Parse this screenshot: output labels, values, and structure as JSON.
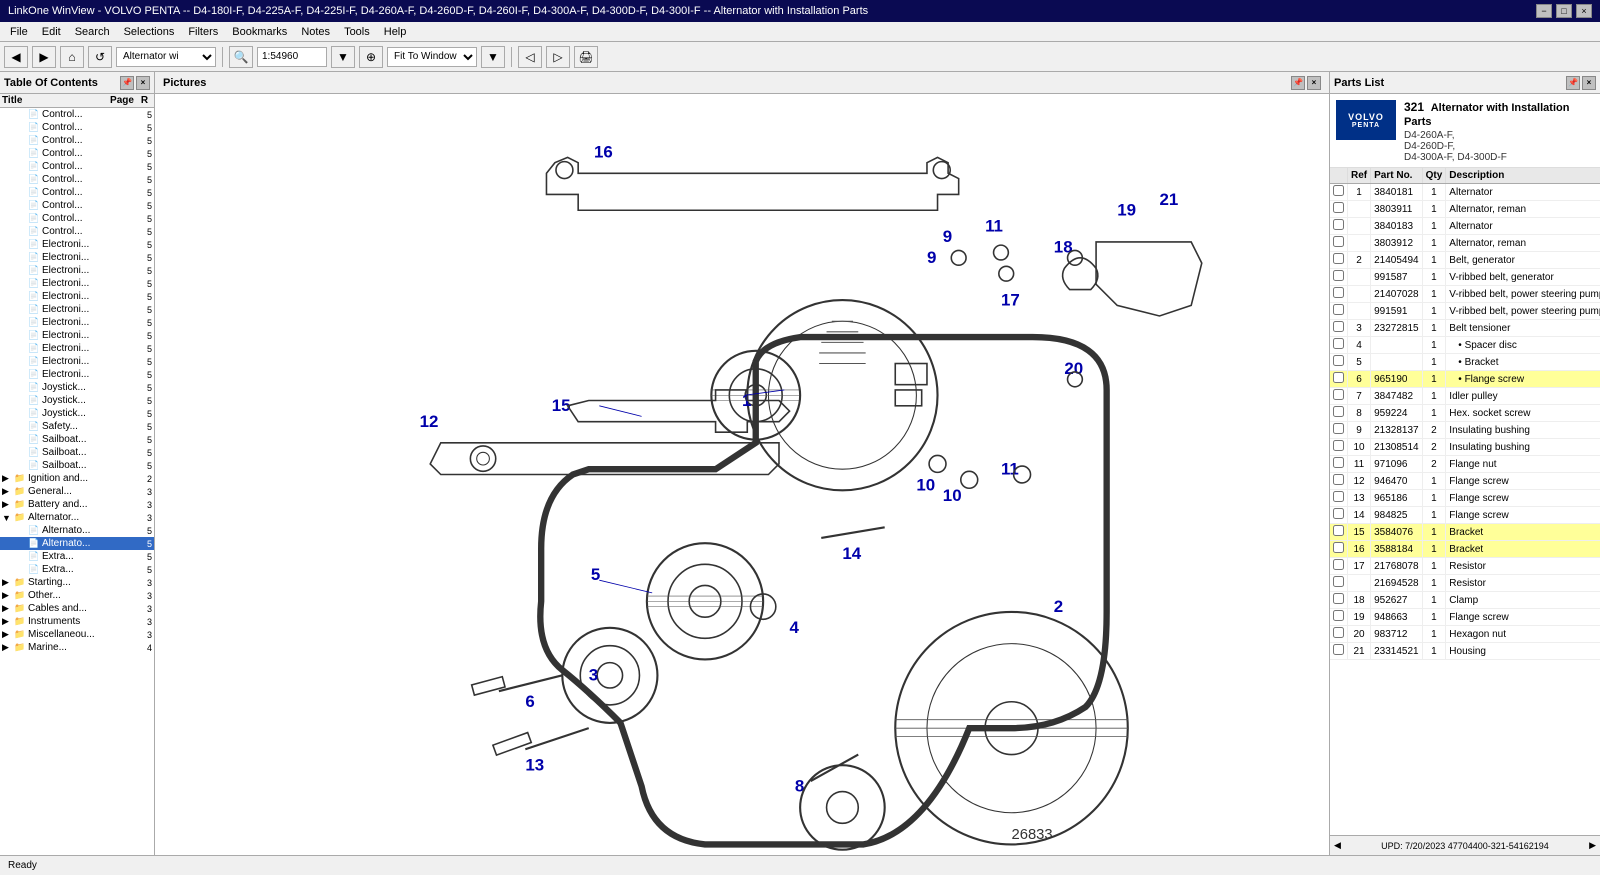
{
  "window": {
    "title": "LinkOne WinView - VOLVO PENTA -- D4-180I-F, D4-225A-F, D4-225I-F, D4-260A-F, D4-260D-F, D4-260I-F, D4-300A-F, D4-300D-F, D4-300I-F -- Alternator with Installation Parts",
    "controls": [
      "−",
      "□",
      "×"
    ]
  },
  "menu": {
    "items": [
      "File",
      "Edit",
      "Search",
      "Selections",
      "Filters",
      "Bookmarks",
      "Notes",
      "Tools",
      "Help"
    ]
  },
  "toolbar": {
    "nav_label": "Alternator wi",
    "zoom_value": "1:54960",
    "zoom_mode": "Fit To Window"
  },
  "toc": {
    "title": "Table Of Contents",
    "columns": [
      "Title",
      "Page",
      "R"
    ],
    "items": [
      {
        "label": "Control...",
        "page": "5",
        "indent": 1,
        "type": "leaf"
      },
      {
        "label": "Control...",
        "page": "5",
        "indent": 1,
        "type": "leaf"
      },
      {
        "label": "Control...",
        "page": "5",
        "indent": 1,
        "type": "leaf"
      },
      {
        "label": "Control...",
        "page": "5",
        "indent": 1,
        "type": "leaf"
      },
      {
        "label": "Control...",
        "page": "5",
        "indent": 1,
        "type": "leaf"
      },
      {
        "label": "Control...",
        "page": "5",
        "indent": 1,
        "type": "leaf"
      },
      {
        "label": "Control...",
        "page": "5",
        "indent": 1,
        "type": "leaf"
      },
      {
        "label": "Control...",
        "page": "5",
        "indent": 1,
        "type": "leaf"
      },
      {
        "label": "Control...",
        "page": "5",
        "indent": 1,
        "type": "leaf"
      },
      {
        "label": "Control...",
        "page": "5",
        "indent": 1,
        "type": "leaf"
      },
      {
        "label": "Electroni...",
        "page": "5",
        "indent": 1,
        "type": "leaf"
      },
      {
        "label": "Electroni...",
        "page": "5",
        "indent": 1,
        "type": "leaf"
      },
      {
        "label": "Electroni...",
        "page": "5",
        "indent": 1,
        "type": "leaf"
      },
      {
        "label": "Electroni...",
        "page": "5",
        "indent": 1,
        "type": "leaf"
      },
      {
        "label": "Electroni...",
        "page": "5",
        "indent": 1,
        "type": "leaf"
      },
      {
        "label": "Electroni...",
        "page": "5",
        "indent": 1,
        "type": "leaf"
      },
      {
        "label": "Electroni...",
        "page": "5",
        "indent": 1,
        "type": "leaf"
      },
      {
        "label": "Electroni...",
        "page": "5",
        "indent": 1,
        "type": "leaf"
      },
      {
        "label": "Electroni...",
        "page": "5",
        "indent": 1,
        "type": "leaf"
      },
      {
        "label": "Electroni...",
        "page": "5",
        "indent": 1,
        "type": "leaf"
      },
      {
        "label": "Electroni...",
        "page": "5",
        "indent": 1,
        "type": "leaf"
      },
      {
        "label": "Joystick...",
        "page": "5",
        "indent": 1,
        "type": "leaf"
      },
      {
        "label": "Joystick...",
        "page": "5",
        "indent": 1,
        "type": "leaf"
      },
      {
        "label": "Joystick...",
        "page": "5",
        "indent": 1,
        "type": "leaf"
      },
      {
        "label": "Safety...",
        "page": "5",
        "indent": 1,
        "type": "leaf"
      },
      {
        "label": "Sailboat...",
        "page": "5",
        "indent": 1,
        "type": "leaf"
      },
      {
        "label": "Sailboat...",
        "page": "5",
        "indent": 1,
        "type": "leaf"
      },
      {
        "label": "Sailboat...",
        "page": "5",
        "indent": 1,
        "type": "leaf"
      },
      {
        "label": "Ignition and...",
        "page": "2",
        "indent": 0,
        "type": "group"
      },
      {
        "label": "General...",
        "page": "3",
        "indent": 0,
        "type": "group"
      },
      {
        "label": "Battery and...",
        "page": "3",
        "indent": 0,
        "type": "group"
      },
      {
        "label": "Alternator...",
        "page": "3",
        "indent": 0,
        "type": "group",
        "expanded": true
      },
      {
        "label": "Alternato...",
        "page": "5",
        "indent": 1,
        "type": "leaf"
      },
      {
        "label": "Alternato...",
        "page": "5",
        "indent": 1,
        "type": "leaf",
        "selected": true
      },
      {
        "label": "Extra...",
        "page": "5",
        "indent": 1,
        "type": "leaf"
      },
      {
        "label": "Extra...",
        "page": "5",
        "indent": 1,
        "type": "leaf"
      },
      {
        "label": "Starting...",
        "page": "3",
        "indent": 0,
        "type": "group"
      },
      {
        "label": "Other...",
        "page": "3",
        "indent": 0,
        "type": "group"
      },
      {
        "label": "Cables and...",
        "page": "3",
        "indent": 0,
        "type": "group"
      },
      {
        "label": "Instruments",
        "page": "3",
        "indent": 0,
        "type": "group"
      },
      {
        "label": "Miscellaneou...",
        "page": "3",
        "indent": 0,
        "type": "group"
      },
      {
        "label": "Marine...",
        "page": "4",
        "indent": 0,
        "type": "group"
      }
    ]
  },
  "pictures": {
    "title": "Pictures",
    "diagram_number": "26833"
  },
  "parts_list": {
    "title": "Parts List",
    "logo": {
      "line1": "VOLVO",
      "line2": "PENTA"
    },
    "part_number": "321",
    "description": "Alternator with Installation Parts",
    "models": "D4-260A-F,\nD4-260D-F,\nD4-300A-F, D4-300D-F",
    "columns": [
      "",
      "Ref",
      "Part No.",
      "Qty",
      "Description"
    ],
    "rows": [
      {
        "ref": "1",
        "part": "3840181",
        "qty": "1",
        "desc": "Alternator",
        "indent": false
      },
      {
        "ref": "",
        "part": "3803911",
        "qty": "1",
        "desc": "Alternator, reman",
        "indent": false
      },
      {
        "ref": "",
        "part": "3840183",
        "qty": "1",
        "desc": "Alternator",
        "indent": false
      },
      {
        "ref": "",
        "part": "3803912",
        "qty": "1",
        "desc": "Alternator, reman",
        "indent": false
      },
      {
        "ref": "2",
        "part": "21405494",
        "qty": "1",
        "desc": "Belt, generator",
        "indent": false
      },
      {
        "ref": "",
        "part": "991587",
        "qty": "1",
        "desc": "V-ribbed belt, generator",
        "indent": false
      },
      {
        "ref": "",
        "part": "21407028",
        "qty": "1",
        "desc": "V-ribbed belt, power steering pump",
        "indent": false
      },
      {
        "ref": "",
        "part": "991591",
        "qty": "1",
        "desc": "V-ribbed belt, power steering pump",
        "indent": false
      },
      {
        "ref": "3",
        "part": "23272815",
        "qty": "1",
        "desc": "Belt tensioner",
        "indent": false
      },
      {
        "ref": "4",
        "part": "",
        "qty": "1",
        "desc": "• Spacer disc",
        "indent": true
      },
      {
        "ref": "5",
        "part": "",
        "qty": "1",
        "desc": "• Bracket",
        "indent": true
      },
      {
        "ref": "6",
        "part": "965190",
        "qty": "1",
        "desc": "• Flange screw",
        "indent": true
      },
      {
        "ref": "7",
        "part": "3847482",
        "qty": "1",
        "desc": "Idler pulley",
        "indent": false
      },
      {
        "ref": "8",
        "part": "959224",
        "qty": "1",
        "desc": "Hex. socket screw",
        "indent": false
      },
      {
        "ref": "9",
        "part": "21328137",
        "qty": "2",
        "desc": "Insulating bushing",
        "indent": false
      },
      {
        "ref": "10",
        "part": "21308514",
        "qty": "2",
        "desc": "Insulating bushing",
        "indent": false
      },
      {
        "ref": "11",
        "part": "971096",
        "qty": "2",
        "desc": "Flange nut",
        "indent": false
      },
      {
        "ref": "12",
        "part": "946470",
        "qty": "1",
        "desc": "Flange screw",
        "indent": false
      },
      {
        "ref": "13",
        "part": "965186",
        "qty": "1",
        "desc": "Flange screw",
        "indent": false
      },
      {
        "ref": "14",
        "part": "984825",
        "qty": "1",
        "desc": "Flange screw",
        "indent": false
      },
      {
        "ref": "15",
        "part": "3584076",
        "qty": "1",
        "desc": "Bracket",
        "indent": false
      },
      {
        "ref": "16",
        "part": "3588184",
        "qty": "1",
        "desc": "Bracket",
        "indent": false
      },
      {
        "ref": "17",
        "part": "21768078",
        "qty": "1",
        "desc": "Resistor",
        "indent": false
      },
      {
        "ref": "",
        "part": "21694528",
        "qty": "1",
        "desc": "Resistor",
        "indent": false
      },
      {
        "ref": "18",
        "part": "952627",
        "qty": "1",
        "desc": "Clamp",
        "indent": false
      },
      {
        "ref": "19",
        "part": "948663",
        "qty": "1",
        "desc": "Flange screw",
        "indent": false
      },
      {
        "ref": "20",
        "part": "983712",
        "qty": "1",
        "desc": "Hexagon nut",
        "indent": false
      },
      {
        "ref": "21",
        "part": "23314521",
        "qty": "1",
        "desc": "Housing",
        "indent": false
      }
    ],
    "footer": "UPD: 7/20/2023    47704400-321-54162194"
  },
  "status_bar": {
    "left": "Ready"
  }
}
